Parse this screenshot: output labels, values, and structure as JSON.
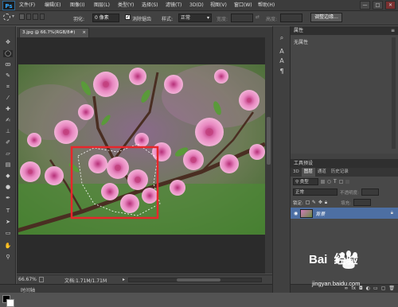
{
  "app": {
    "logo": "Ps"
  },
  "menubar": {
    "items": [
      "文件(F)",
      "编辑(E)",
      "图像(I)",
      "图层(L)",
      "类型(Y)",
      "选择(S)",
      "滤镜(T)",
      "3D(D)",
      "视图(V)",
      "窗口(W)",
      "帮助(H)"
    ],
    "window_controls": [
      "—",
      "□",
      "✕"
    ]
  },
  "options": {
    "feather_label": "羽化:",
    "feather_value": "0 像素",
    "antialias_label": "消除锯齿",
    "style_label": "样式:",
    "style_value": "正常",
    "width_label": "宽度:",
    "height_label": "高度:",
    "refine_button": "调整边缘..."
  },
  "document": {
    "tab_title": "3.jpg @ 66.7%(RGB/8#)",
    "tab_close": "×"
  },
  "status": {
    "zoom": "66.67%",
    "doc_info": "文档:1.71M/1.71M",
    "timeline_label": "时间轴"
  },
  "properties": {
    "title": "属性",
    "content": "无属性"
  },
  "tool_presets": {
    "title": "工具预设"
  },
  "layers": {
    "tabs": [
      "3D",
      "图层",
      "通道",
      "历史记录"
    ],
    "active_tab": "图层",
    "kind_filter": "类型",
    "blend_mode": "正常",
    "opacity_label": "不透明度:",
    "lock_label": "锁定:",
    "fill_label": "填充:",
    "layer_name": "背景"
  },
  "watermark": {
    "brand": "Bai  经验",
    "url": "jingyan.baidu.com"
  },
  "colors": {
    "selection_rect": "#e8262b",
    "layer_selected": "#4d6fa3",
    "accent_ps": "#31a8ff"
  }
}
